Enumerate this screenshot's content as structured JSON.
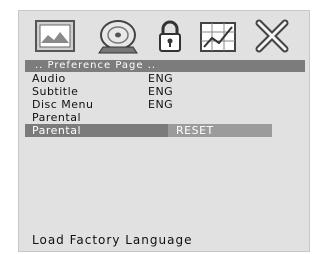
{
  "tabs": [
    {
      "icon": "picture-icon"
    },
    {
      "icon": "disc-icon"
    },
    {
      "icon": "lock-icon"
    },
    {
      "icon": "chart-icon"
    },
    {
      "icon": "close-icon"
    }
  ],
  "page": {
    "header": ".. Preference Page .."
  },
  "menu": {
    "items": [
      {
        "label": "Audio",
        "value": "ENG"
      },
      {
        "label": "Subtitle",
        "value": "ENG"
      },
      {
        "label": "Disc Menu",
        "value": "ENG"
      },
      {
        "label": "Parental",
        "value": ""
      },
      {
        "label": "Parental",
        "value": "RESET"
      }
    ]
  },
  "footer": {
    "hint": "Load Factory Language"
  }
}
